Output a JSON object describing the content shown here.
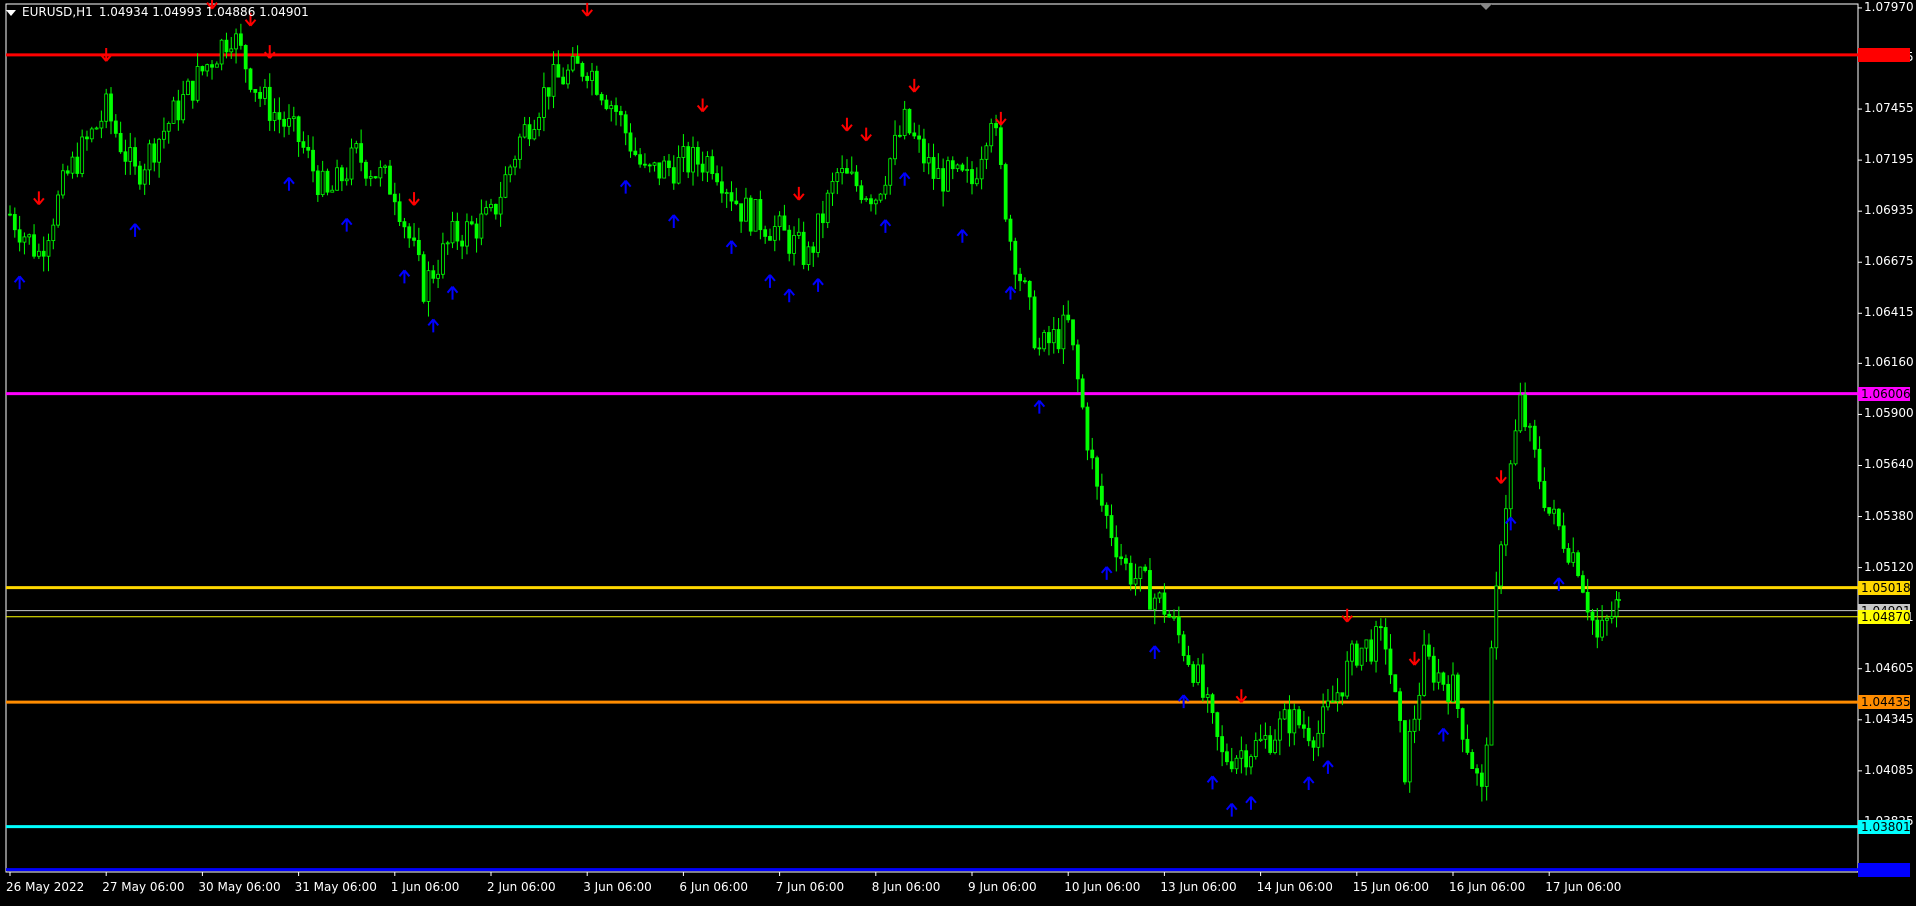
{
  "chart_header": {
    "symbol_timeframe": "EURUSD,H1",
    "ohlc": "1.04934 1.04993 1.04886 1.04901"
  },
  "price_axis": {
    "ticks": [
      "1.07970",
      "1.07715",
      "1.07455",
      "1.07195",
      "1.06935",
      "1.06675",
      "1.06415",
      "1.06160",
      "1.05900",
      "1.05640",
      "1.05380",
      "1.05120",
      "1.04861",
      "1.04605",
      "1.04345",
      "1.04085",
      "1.03825"
    ]
  },
  "time_axis": {
    "ticks": [
      "26 May 2022",
      "27 May 06:00",
      "30 May 06:00",
      "31 May 06:00",
      "1 Jun 06:00",
      "2 Jun 06:00",
      "3 Jun 06:00",
      "6 Jun 06:00",
      "7 Jun 06:00",
      "8 Jun 06:00",
      "9 Jun 06:00",
      "10 Jun 06:00",
      "13 Jun 06:00",
      "14 Jun 06:00",
      "15 Jun 06:00",
      "16 Jun 06:00",
      "17 Jun 06:00"
    ]
  },
  "levels": [
    {
      "name": "red-level",
      "price": 1.07731,
      "label": "1.07731",
      "color": "#ff0000",
      "text_color": "#ff0000"
    },
    {
      "name": "magenta-level",
      "price": 1.06006,
      "label": "1.06006",
      "color": "#ff00ff",
      "text_color": "#000000"
    },
    {
      "name": "yellow-level",
      "price": 1.05018,
      "label": "1.05018",
      "color": "#ffd700",
      "text_color": "#000000"
    },
    {
      "name": "current-price-level",
      "price": 1.04901,
      "label": "1.04901",
      "color": "#c8c8c8",
      "text_color": "#000000"
    },
    {
      "name": "yellow-level-lower",
      "price": 1.0487,
      "label": "1.04870",
      "color": "#ffff00",
      "text_color": "#000000"
    },
    {
      "name": "orange-level",
      "price": 1.04435,
      "label": "1.04435",
      "color": "#ff8c00",
      "text_color": "#000000"
    },
    {
      "name": "cyan-level",
      "price": 1.03801,
      "label": "1.03801",
      "color": "#00ffff",
      "text_color": "#000000"
    },
    {
      "name": "blue-level",
      "price": 1.03582,
      "label": "1.03582",
      "color": "#0000ff",
      "text_color": "#0000ff"
    }
  ],
  "colors": {
    "background": "#000000",
    "candle": "#00ff00",
    "down_arrow": "#ff0000",
    "up_arrow": "#0000ff",
    "axis": "#ffffff"
  },
  "chart_data": {
    "type": "candlestick",
    "symbol": "EURUSD",
    "timeframe": "H1",
    "ylim": [
      1.0357,
      1.0799
    ],
    "xlabel": "",
    "ylabel": "",
    "x": [
      "26 May 2022",
      "27 May 06:00",
      "30 May 06:00",
      "31 May 06:00",
      "1 Jun 06:00",
      "2 Jun 06:00",
      "3 Jun 06:00",
      "6 Jun 06:00",
      "7 Jun 06:00",
      "8 Jun 06:00",
      "9 Jun 06:00",
      "10 Jun 06:00",
      "13 Jun 06:00",
      "14 Jun 06:00",
      "15 Jun 06:00",
      "16 Jun 06:00",
      "17 Jun 06:00"
    ],
    "close_path": [
      [
        0,
        1.0692
      ],
      [
        0.3,
        1.0672
      ],
      [
        0.6,
        1.0712
      ],
      [
        1,
        1.0745
      ],
      [
        1.3,
        1.0712
      ],
      [
        1.6,
        1.0735
      ],
      [
        2,
        1.0765
      ],
      [
        2.3,
        1.0785
      ],
      [
        2.6,
        1.0752
      ],
      [
        3,
        1.073
      ],
      [
        3.3,
        1.07
      ],
      [
        3.6,
        1.0722
      ],
      [
        4,
        1.0705
      ],
      [
        4.3,
        1.0655
      ],
      [
        4.6,
        1.068
      ],
      [
        5,
        1.069
      ],
      [
        5.3,
        1.073
      ],
      [
        5.6,
        1.0758
      ],
      [
        6,
        1.0768
      ],
      [
        6.3,
        1.0745
      ],
      [
        6.6,
        1.0712
      ],
      [
        7,
        1.0718
      ],
      [
        7.3,
        1.072
      ],
      [
        7.6,
        1.0695
      ],
      [
        8,
        1.0683
      ],
      [
        8.3,
        1.067
      ],
      [
        8.6,
        1.0712
      ],
      [
        9,
        1.0702
      ],
      [
        9.3,
        1.0738
      ],
      [
        9.6,
        1.0712
      ],
      [
        10,
        1.0708
      ],
      [
        10.2,
        1.0745
      ],
      [
        10.4,
        1.068
      ],
      [
        10.7,
        1.0622
      ],
      [
        11,
        1.0635
      ],
      [
        11.3,
        1.055
      ],
      [
        11.6,
        1.0512
      ],
      [
        12,
        1.0492
      ],
      [
        12.3,
        1.0462
      ],
      [
        12.6,
        1.0415
      ],
      [
        13,
        1.0422
      ],
      [
        13.3,
        1.0435
      ],
      [
        13.6,
        1.0428
      ],
      [
        14,
        1.047
      ],
      [
        14.3,
        1.0475
      ],
      [
        14.5,
        1.041
      ],
      [
        14.7,
        1.0465
      ],
      [
        15,
        1.045
      ],
      [
        15.3,
        1.0395
      ],
      [
        15.5,
        1.053
      ],
      [
        15.7,
        1.0595
      ],
      [
        16,
        1.054
      ],
      [
        16.3,
        1.0515
      ],
      [
        16.5,
        1.0475
      ],
      [
        16.7,
        1.0492
      ],
      [
        16.75,
        1.049
      ]
    ],
    "down_arrows": [
      0.3,
      1,
      2.1,
      2.5,
      2.7,
      4.2,
      6,
      7.2,
      8.2,
      8.7,
      8.9,
      9.4,
      10.3,
      15.5,
      12.8,
      13.9,
      14.6
    ],
    "up_arrows": [
      0.1,
      1.3,
      2.9,
      3.5,
      4.1,
      4.4,
      4.6,
      6.4,
      6.9,
      7.5,
      7.9,
      8.1,
      8.4,
      9.1,
      9.3,
      9.9,
      10.4,
      10.7,
      11.4,
      11.9,
      12.2,
      12.5,
      12.7,
      12.9,
      13.5,
      13.7,
      14.9,
      15.6,
      16.1
    ],
    "levels": [
      1.07731,
      1.06006,
      1.05018,
      1.04901,
      1.0487,
      1.04435,
      1.03801,
      1.03582
    ]
  }
}
